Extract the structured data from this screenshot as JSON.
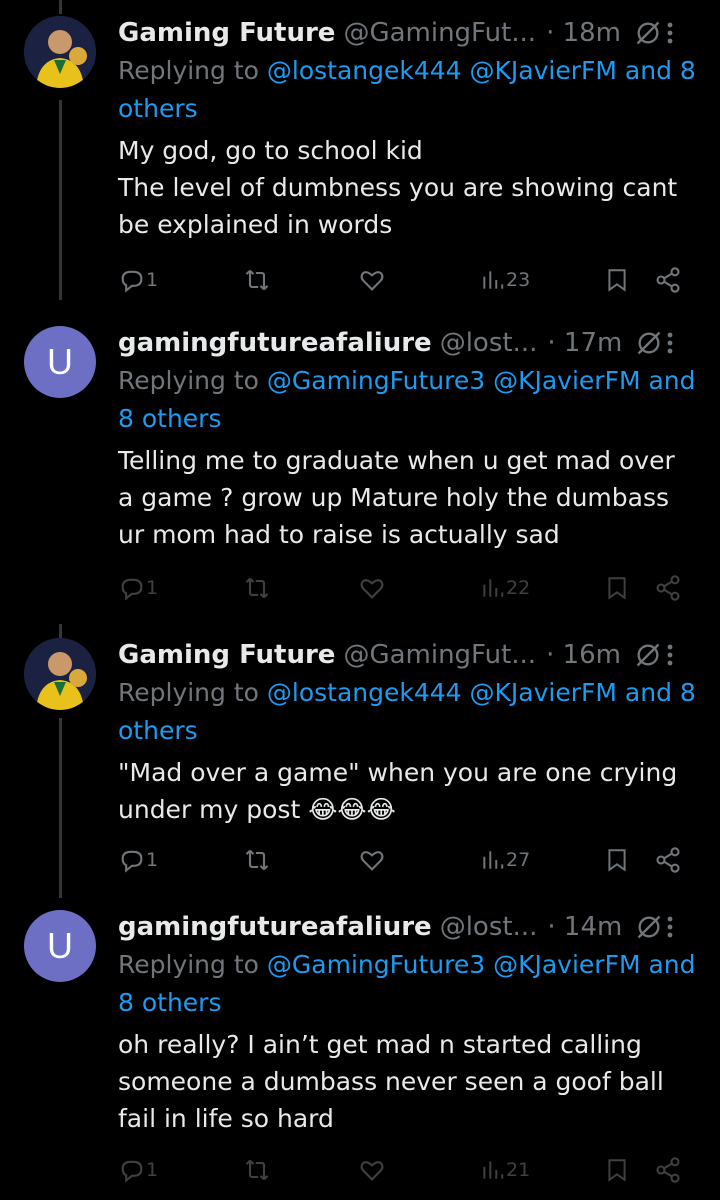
{
  "tweets": [
    {
      "author": {
        "name": "Gaming Future",
        "handle": "@GamingFut...",
        "avatar": "photo"
      },
      "time": "· 18m",
      "reply_prefix": "Replying to",
      "reply_mentions": "@lostangek444 @KJavierFM",
      "reply_tail": "and",
      "reply_others": "8 others",
      "text": "My god, go to school kid\nThe level of dumbness you are showing cant be explained in words",
      "stats": {
        "replies": "1",
        "views": "23"
      }
    },
    {
      "author": {
        "name": "gamingfutureafaliure",
        "handle": "@lost...",
        "avatar": "U"
      },
      "time": "· 17m",
      "reply_prefix": "Replying to",
      "reply_mentions": "@GamingFuture3 @KJavierFM",
      "reply_tail": "and",
      "reply_others": "8 others",
      "text": "Telling me to graduate when u get mad over a game ? grow up Mature holy the dumbass ur mom had to raise is actually sad",
      "stats": {
        "replies": "1",
        "views": "22"
      }
    },
    {
      "author": {
        "name": "Gaming Future",
        "handle": "@GamingFut...",
        "avatar": "photo"
      },
      "time": "· 16m",
      "reply_prefix": "Replying to",
      "reply_mentions": "@lostangek444 @KJavierFM",
      "reply_tail": "and",
      "reply_others": "8 others",
      "text": "\"Mad over a game\" when you are one crying under my post 😂😂😂",
      "stats": {
        "replies": "1",
        "views": "27"
      }
    },
    {
      "author": {
        "name": "gamingfutureafaliure",
        "handle": "@lost...",
        "avatar": "U"
      },
      "time": "· 14m",
      "reply_prefix": "Replying to",
      "reply_mentions": "@GamingFuture3 @KJavierFM",
      "reply_tail": "and",
      "reply_others": "8 others",
      "text": "oh really? I ain’t get mad n started calling someone a dumbass never seen a goof ball fail in life so hard",
      "stats": {
        "replies": "1",
        "views": "21"
      }
    }
  ],
  "icons": {
    "reply": "reply-icon",
    "retweet": "retweet-icon",
    "like": "heart-icon",
    "views": "views-icon",
    "bookmark": "bookmark-icon",
    "share": "share-icon",
    "grok": "grok-icon",
    "more": "more-options-icon"
  },
  "colors": {
    "link": "#1d9bf0",
    "muted": "#71767b",
    "text": "#e7e9ea",
    "avatar_u": "#6c6fc4"
  }
}
